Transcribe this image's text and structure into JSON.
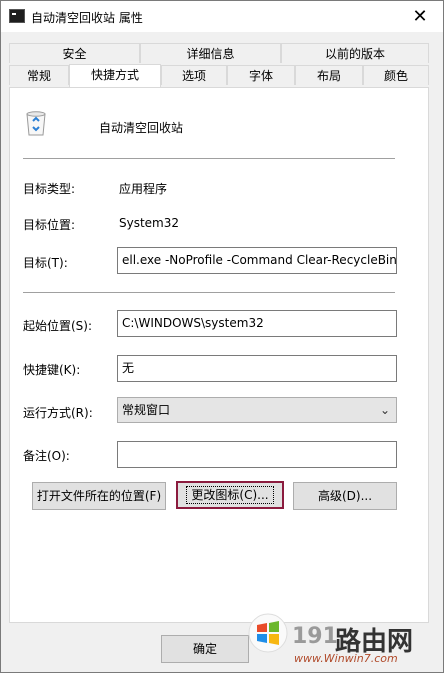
{
  "window": {
    "title": "自动清空回收站 属性",
    "close_glyph": "✕"
  },
  "tabs_top": [
    "安全",
    "详细信息",
    "以前的版本"
  ],
  "tabs_bottom": [
    "常规",
    "快捷方式",
    "选项",
    "字体",
    "布局",
    "颜色"
  ],
  "active_tab": "快捷方式",
  "shortcut": {
    "name": "自动清空回收站",
    "target_type_label": "目标类型:",
    "target_type_value": "应用程序",
    "target_location_label": "目标位置:",
    "target_location_value": "System32",
    "target_label": "目标(T):",
    "target_value": "ell.exe -NoProfile -Command Clear-RecycleBin\"",
    "start_in_label": "起始位置(S):",
    "start_in_value": "C:\\WINDOWS\\system32",
    "hotkey_label": "快捷键(K):",
    "hotkey_value": "无",
    "run_label": "运行方式(R):",
    "run_value": "常规窗口",
    "comment_label": "备注(O):",
    "comment_value": "",
    "open_location_button": "打开文件所在的位置(F)",
    "change_icon_button": "更改图标(C)...",
    "advanced_button": "高级(D)..."
  },
  "footer": {
    "ok_button": "确定"
  },
  "watermark": {
    "brand_prefix": "191",
    "brand_main": "路由网",
    "url": "www.Winwin7.com"
  },
  "colors": {
    "focus_border": "#8b1b3e",
    "recycle_blue": "#2b7fd4"
  }
}
